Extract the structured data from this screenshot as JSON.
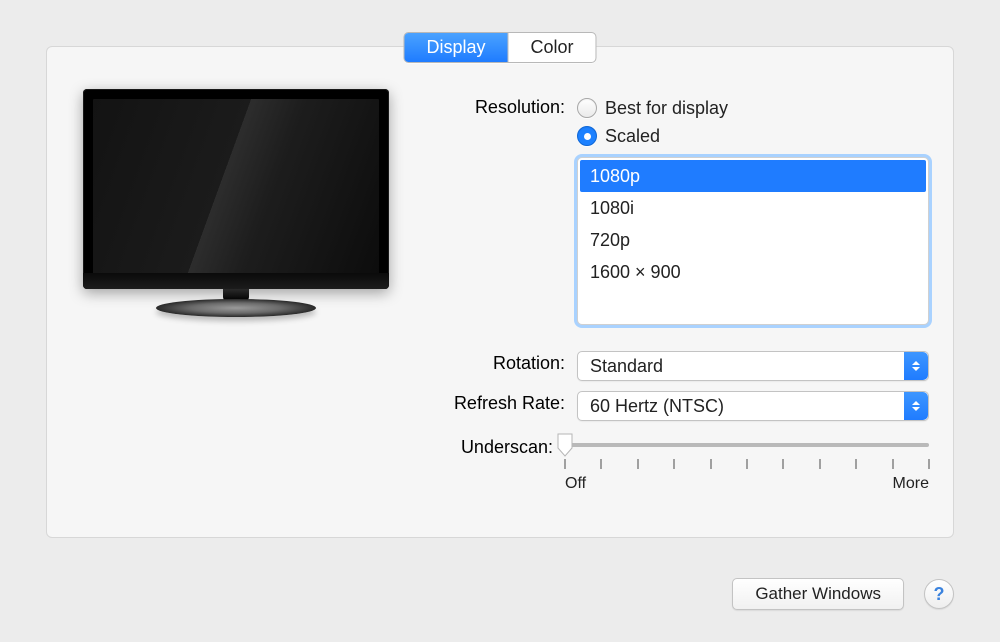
{
  "tabs": {
    "display": "Display",
    "color": "Color",
    "active": "display"
  },
  "labels": {
    "resolution": "Resolution:",
    "rotation": "Rotation:",
    "refresh_rate": "Refresh Rate:",
    "underscan": "Underscan:"
  },
  "resolution": {
    "option_best": "Best for display",
    "option_scaled": "Scaled",
    "selected": "scaled",
    "list": [
      "1080p",
      "1080i",
      "720p",
      "1600 × 900"
    ],
    "list_selected_index": 0
  },
  "rotation": {
    "value": "Standard"
  },
  "refresh_rate": {
    "value": "60 Hertz (NTSC)"
  },
  "underscan": {
    "left": "Off",
    "right": "More",
    "tick_count": 11,
    "value": 0
  },
  "buttons": {
    "gather_windows": "Gather Windows",
    "help": "?"
  }
}
